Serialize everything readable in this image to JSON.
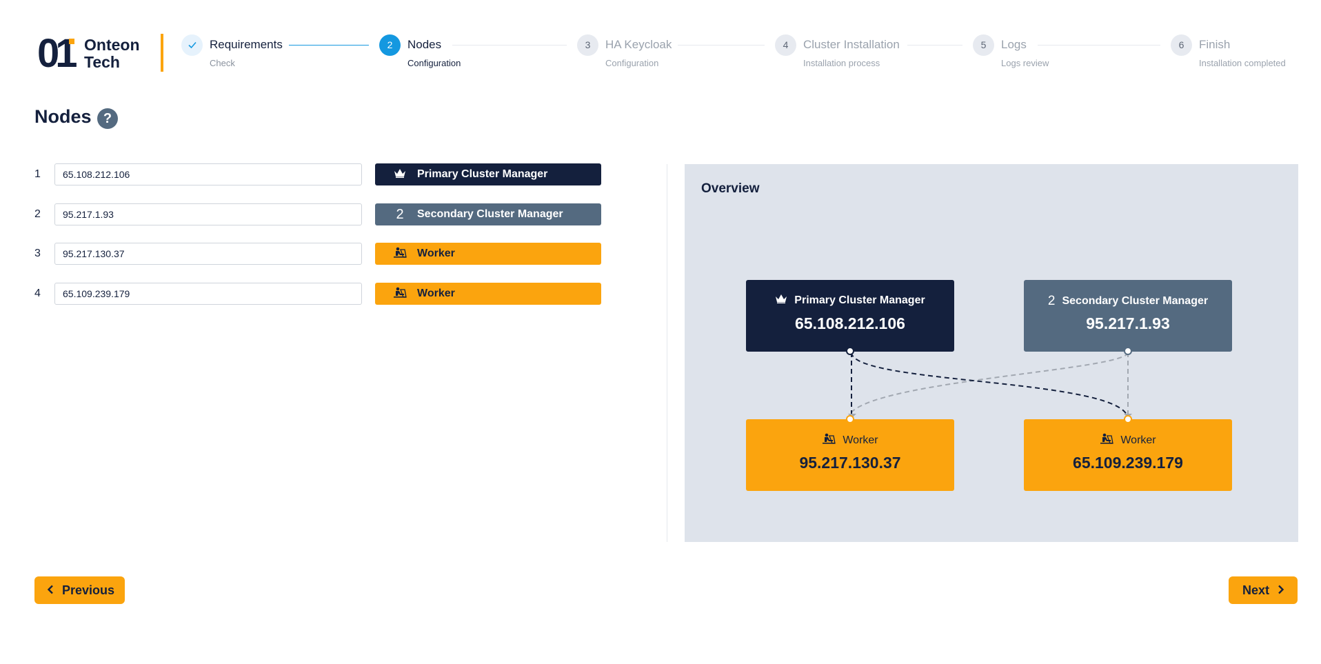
{
  "brand": {
    "logo_mark": "01",
    "name_line1": "Onteon",
    "name_line2": "Tech"
  },
  "stepper": [
    {
      "number": "",
      "title": "Requirements",
      "subtitle": "Check",
      "state": "done",
      "icon": "check-icon"
    },
    {
      "number": "2",
      "title": "Nodes",
      "subtitle": "Configuration",
      "state": "active"
    },
    {
      "number": "3",
      "title": "HA Keycloak",
      "subtitle": "Configuration",
      "state": "pending"
    },
    {
      "number": "4",
      "title": "Cluster Installation",
      "subtitle": "Installation process",
      "state": "pending"
    },
    {
      "number": "5",
      "title": "Logs",
      "subtitle": "Logs review",
      "state": "pending"
    },
    {
      "number": "6",
      "title": "Finish",
      "subtitle": "Installation completed",
      "state": "pending"
    }
  ],
  "page": {
    "title": "Nodes",
    "help_icon": "question-icon",
    "help_glyph": "?"
  },
  "nodes": [
    {
      "index": "1",
      "ip": "65.108.212.106",
      "role": "Primary Cluster Manager",
      "role_icon": "crown-icon"
    },
    {
      "index": "2",
      "ip": "95.217.1.93",
      "role": "Secondary Cluster Manager",
      "role_icon": "number-2-icon",
      "role_glyph": "2"
    },
    {
      "index": "3",
      "ip": "95.217.130.37",
      "role": "Worker",
      "role_icon": "worker-icon"
    },
    {
      "index": "4",
      "ip": "65.109.239.179",
      "role": "Worker",
      "role_icon": "worker-icon"
    }
  ],
  "overview": {
    "title": "Overview",
    "cards": [
      {
        "role": "Primary Cluster Manager",
        "ip": "65.108.212.106",
        "role_icon": "crown-icon"
      },
      {
        "role": "Secondary Cluster Manager",
        "ip": "95.217.1.93",
        "role_icon": "number-2-icon",
        "role_glyph": "2"
      },
      {
        "role": "Worker",
        "ip": "95.217.130.37",
        "role_icon": "worker-icon"
      },
      {
        "role": "Worker",
        "ip": "65.109.239.179",
        "role_icon": "worker-icon"
      }
    ]
  },
  "footer": {
    "previous_label": "Previous",
    "next_label": "Next",
    "prev_icon": "chevron-left-icon",
    "next_icon": "chevron-right-icon"
  },
  "colors": {
    "primary": "#14203d",
    "secondary": "#546a80",
    "worker": "#fba40e",
    "accent_blue": "#1498e0",
    "overview_bg": "#dee3eb"
  }
}
